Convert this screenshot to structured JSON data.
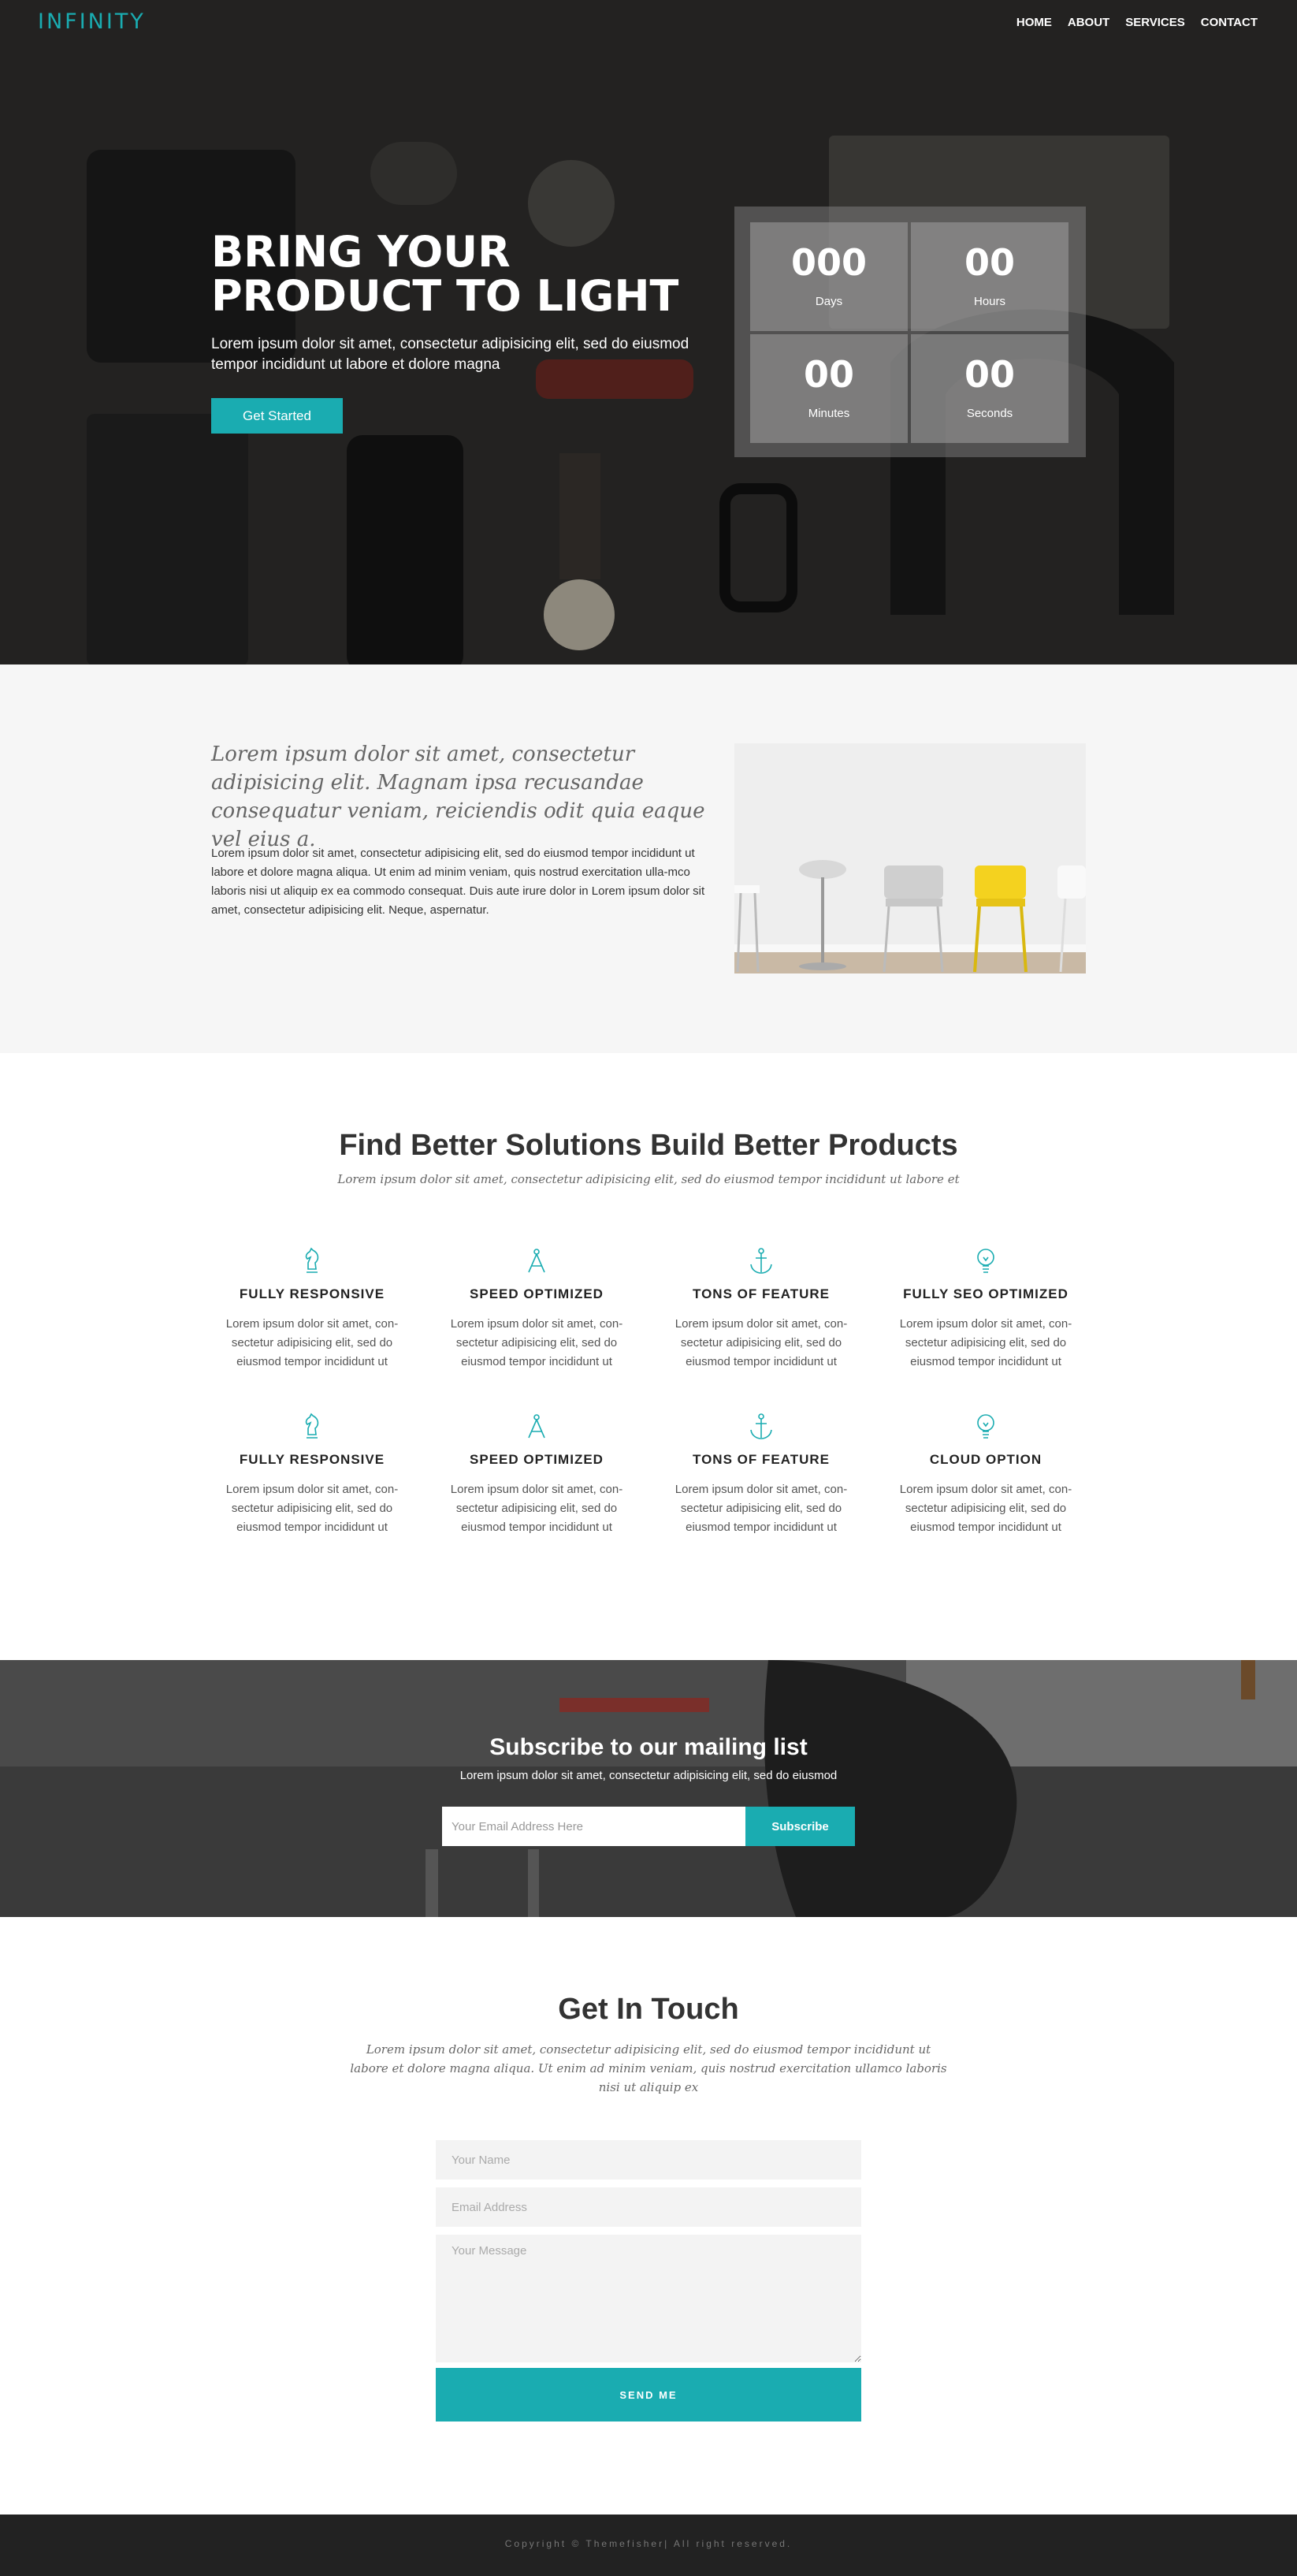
{
  "brand": {
    "logo": "INFINITY",
    "accent": "#1aacb1"
  },
  "nav": {
    "items": [
      "HOME",
      "ABOUT",
      "SERVICES",
      "CONTACT"
    ]
  },
  "hero": {
    "title": "BRING YOUR PRODUCT TO LIGHT",
    "subtitle": "Lorem ipsum dolor sit amet, consectetur adipisicing elit, sed do eiusmod tempor incididunt ut labore et dolore magna",
    "button": "Get Started",
    "countdown": [
      {
        "value": "000",
        "label": "Days"
      },
      {
        "value": "00",
        "label": "Hours"
      },
      {
        "value": "00",
        "label": "Minutes"
      },
      {
        "value": "00",
        "label": "Seconds"
      }
    ]
  },
  "about": {
    "lead": "Lorem ipsum dolor sit amet, consectetur adipisicing elit. Magnam ipsa recusandae consequatur veniam, reiciendis odit quia eaque vel eius a.",
    "body": "Lorem ipsum dolor sit amet, consectetur adipisicing elit, sed do eiusmod tempor incididunt ut labore et dolore magna aliqua. Ut enim ad minim veniam, quis nostrud exercitation ulla-mco laboris nisi ut aliquip ex ea commodo consequat. Duis aute irure dolor in Lorem ipsum dolor sit amet, consectetur adipisicing elit. Neque, aspernatur."
  },
  "features": {
    "title": "Find Better Solutions Build Better Products",
    "subtitle": "Lorem ipsum dolor sit amet, consectetur adipisicing elit, sed do eiusmod tempor incididunt ut labore et",
    "items": [
      {
        "icon": "chess-knight-icon",
        "title": "FULLY RESPONSIVE",
        "text": "Lorem ipsum dolor sit amet, con-sectetur adipisicing elit, sed do eiusmod tempor incididunt ut"
      },
      {
        "icon": "compass-icon",
        "title": "SPEED OPTIMIZED",
        "text": "Lorem ipsum dolor sit amet, con-sectetur adipisicing elit, sed do eiusmod tempor incididunt ut"
      },
      {
        "icon": "anchor-icon",
        "title": "TONS OF FEATURE",
        "text": "Lorem ipsum dolor sit amet, con-sectetur adipisicing elit, sed do eiusmod tempor incididunt ut"
      },
      {
        "icon": "lightbulb-icon",
        "title": "FULLY SEO OPTIMIZED",
        "text": "Lorem ipsum dolor sit amet, con-sectetur adipisicing elit, sed do eiusmod tempor incididunt ut"
      },
      {
        "icon": "chess-knight-icon",
        "title": "FULLY RESPONSIVE",
        "text": "Lorem ipsum dolor sit amet, con-sectetur adipisicing elit, sed do eiusmod tempor incididunt ut"
      },
      {
        "icon": "compass-icon",
        "title": "SPEED OPTIMIZED",
        "text": "Lorem ipsum dolor sit amet, con-sectetur adipisicing elit, sed do eiusmod tempor incididunt ut"
      },
      {
        "icon": "anchor-icon",
        "title": "TONS OF FEATURE",
        "text": "Lorem ipsum dolor sit amet, con-sectetur adipisicing elit, sed do eiusmod tempor incididunt ut"
      },
      {
        "icon": "lightbulb-icon",
        "title": "CLOUD OPTION",
        "text": "Lorem ipsum dolor sit amet, con-sectetur adipisicing elit, sed do eiusmod tempor incididunt ut"
      }
    ]
  },
  "subscribe": {
    "title": "Subscribe to our mailing list",
    "text": "Lorem ipsum dolor sit amet, consectetur adipisicing elit, sed do eiusmod",
    "placeholder": "Your Email Address Here",
    "button": "Subscribe"
  },
  "contact": {
    "title": "Get In Touch",
    "subtitle": "Lorem ipsum dolor sit amet, consectetur adipisicing elit, sed do eiusmod tempor incididunt ut labore et dolore magna aliqua. Ut enim ad minim veniam, quis nostrud exercitation ullamco laboris nisi ut aliquip ex",
    "name_placeholder": "Your Name",
    "email_placeholder": "Email Address",
    "message_placeholder": "Your Message",
    "button": "SEND ME"
  },
  "footer": {
    "text": "Copyright © Themefisher| All right reserved."
  }
}
